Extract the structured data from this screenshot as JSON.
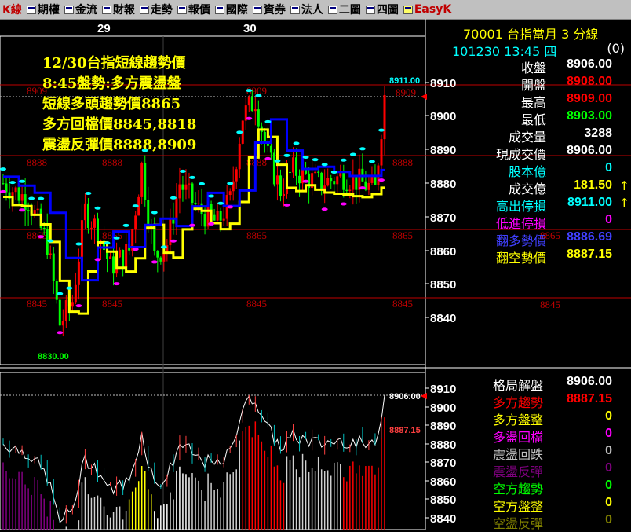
{
  "menu": [
    {
      "label": "K線",
      "icon": "k-icon",
      "accent": "red"
    },
    {
      "label": "期權",
      "icon": "window-icon"
    },
    {
      "label": "金流",
      "icon": "window-icon"
    },
    {
      "label": "財報",
      "icon": "window-icon"
    },
    {
      "label": "走勢",
      "icon": "window-icon"
    },
    {
      "label": "報價",
      "icon": "window-icon"
    },
    {
      "label": "國際",
      "icon": "window-icon"
    },
    {
      "label": "資券",
      "icon": "window-icon"
    },
    {
      "label": "法人",
      "icon": "window-icon"
    },
    {
      "label": "二圖",
      "icon": "window-icon"
    },
    {
      "label": "四圖",
      "icon": "window-icon"
    },
    {
      "label": "EasyK",
      "icon": "easyk-logo-icon",
      "accent": "red"
    }
  ],
  "dates": [
    "29",
    "30"
  ],
  "header": {
    "code_name": "70001  台指當月 3 分線",
    "timestamp": "101230 13:45 四",
    "count": "(0)"
  },
  "annotation": [
    "12/30台指短線趨勢價",
    "8:45盤勢:多方震盪盤",
    "短線多頭趨勢價8865",
    "多方回檔價8845,8818",
    "震盪反彈價8888,8909"
  ],
  "upper_axis": {
    "ticks": [
      "8910",
      "8900",
      "8890",
      "8880",
      "8870",
      "8860",
      "8850",
      "8840"
    ]
  },
  "lower_axis": {
    "ticks": [
      "8910",
      "8900",
      "8890",
      "8880",
      "8870",
      "8860",
      "8850",
      "8840"
    ]
  },
  "chart_labels": {
    "high_tag": "8911.00",
    "low_tag": "8830.00",
    "last_tag": "8906.00",
    "trend_tag": "8887.15",
    "ref_8909": "8909",
    "ref_8888": "8888",
    "ref_8865": "8865",
    "ref_8845": "8845"
  },
  "quote": [
    {
      "label": "收盤",
      "value": "8906.00",
      "color": "#ffffff"
    },
    {
      "label": "開盤",
      "value": "8908.00",
      "color": "#ff0000"
    },
    {
      "label": "最高",
      "value": "8909.00",
      "color": "#ff0000"
    },
    {
      "label": "最低",
      "value": "8903.00",
      "color": "#00ff00"
    },
    {
      "label": "成交量",
      "value": "3288",
      "color": "#ffffff"
    },
    {
      "label": "現成交價",
      "value": "8906.00",
      "color": "#ffffff"
    },
    {
      "label": "股本億",
      "value": "0",
      "color": "#00ffff",
      "label_color": "#00ffff"
    },
    {
      "label": "成交億",
      "value": "181.50",
      "color": "#ffff00",
      "arrow": "↑"
    },
    {
      "label": "高出停損",
      "value": "8911.00",
      "color": "#00ffff",
      "label_color": "#00ffff",
      "arrow": "↑"
    },
    {
      "label": "低進停損",
      "value": "0",
      "color": "#ff00ff",
      "label_color": "#ff00ff"
    },
    {
      "label": "翻多勢價",
      "value": "8886.69",
      "color": "#4040ff",
      "label_color": "#4040ff"
    },
    {
      "label": "翻空勢價",
      "value": "8887.15",
      "color": "#ffff00",
      "label_color": "#ffff00"
    }
  ],
  "pattern": [
    {
      "label": "格局解盤",
      "value": "8906.00",
      "label_color": "#ffffff",
      "color": "#ffffff"
    },
    {
      "label": "多方趨勢",
      "value": "8887.15",
      "label_color": "#ff0000",
      "color": "#ff0000"
    },
    {
      "label": "多方盤整",
      "value": "0",
      "label_color": "#ffff00",
      "color": "#ffff00"
    },
    {
      "label": "多盪回檔",
      "value": "0",
      "label_color": "#ff00ff",
      "color": "#ff00ff"
    },
    {
      "label": "震盪回跌",
      "value": "0",
      "label_color": "#c0c0c0",
      "color": "#c0c0c0"
    },
    {
      "label": "震盪反彈",
      "value": "0",
      "label_color": "#800080",
      "color": "#800080"
    },
    {
      "label": "空方趨勢",
      "value": "0",
      "label_color": "#00ff00",
      "color": "#00ff00"
    },
    {
      "label": "空方盤整",
      "value": "0",
      "label_color": "#ffff00",
      "color": "#ffff00"
    },
    {
      "label": "空盪反彈",
      "value": "0",
      "label_color": "#808000",
      "color": "#808000"
    }
  ],
  "chart_data": {
    "type": "candlestick",
    "ylim": [
      8830,
      8915
    ],
    "reference_levels": [
      8909,
      8888,
      8865,
      8845
    ],
    "last_price": 8906,
    "high": 8911,
    "low": 8830
  }
}
